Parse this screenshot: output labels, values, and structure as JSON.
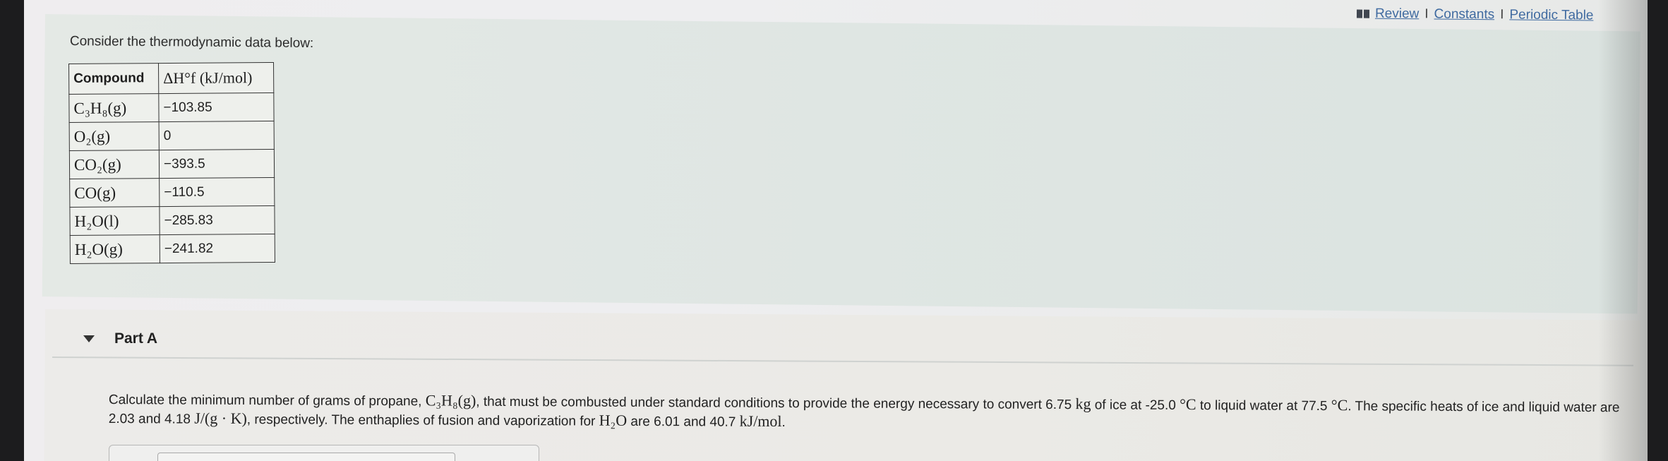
{
  "links": {
    "review": "Review",
    "constants": "Constants",
    "periodic_table": "Periodic Table",
    "sep": "I"
  },
  "intro": "Consider the thermodynamic data below:",
  "table": {
    "headers": [
      "Compound",
      "ΔH°f (kJ/mol)"
    ],
    "rows": [
      {
        "compound": "C₃H₈(g)",
        "value": "−103.85"
      },
      {
        "compound": "O₂(g)",
        "value": "0"
      },
      {
        "compound": "CO₂(g)",
        "value": "−393.5"
      },
      {
        "compound": "CO(g)",
        "value": "−110.5"
      },
      {
        "compound": "H₂O(l)",
        "value": "−285.83"
      },
      {
        "compound": "H₂O(g)",
        "value": "−241.82"
      }
    ]
  },
  "part_a": {
    "title": "Part A",
    "q1": "Calculate the minimum number of grams of propane, ",
    "q_propane": "C₃H₈(g)",
    "q2": ", that must be combusted under standard conditions to provide the energy necessary to convert 6.75 ",
    "q_kg": "kg",
    "q3": " of ice at -25.0 ",
    "q_degc1": "°C",
    "q4": " to liquid water at 77.5 ",
    "q_degc2": "°C",
    "q5": ". The specific heats of ice and liquid water are 2.03 and 4.18 ",
    "q_unit": "J/(g · K)",
    "q6": ", respectively. The enthaplies of fusion and vaporization for ",
    "q_h2o": "H₂O",
    "q7": " are 6.01 and 40.7 ",
    "q_kjmol": "kJ/mol",
    "q8": "."
  }
}
